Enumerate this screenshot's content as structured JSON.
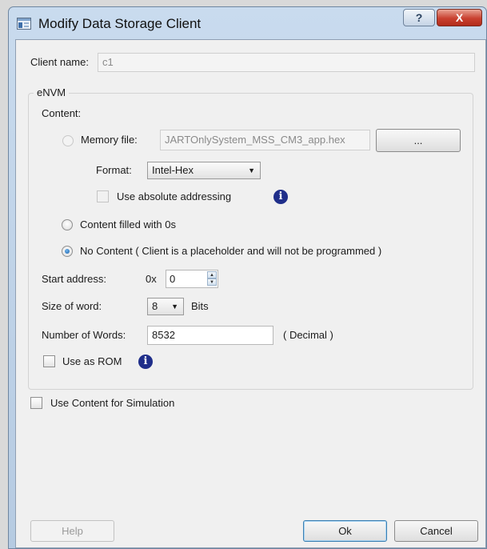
{
  "window": {
    "title": "Modify Data Storage Client",
    "help_glyph": "?",
    "close_glyph": "X"
  },
  "client_name": {
    "label": "Client name:",
    "value": "c1"
  },
  "envm": {
    "group_title": "eNVM",
    "content_label": "Content:",
    "memory_file": {
      "radio_label": "Memory file:",
      "path": "JARTOnlySystem_MSS_CM3_app.hex",
      "browse_label": "..."
    },
    "format": {
      "label": "Format:",
      "value": "Intel-Hex"
    },
    "absolute_addressing": {
      "label": "Use absolute addressing",
      "checked": false
    },
    "filled_zeros": {
      "label": "Content filled with 0s"
    },
    "no_content": {
      "label": "No Content ( Client is a placeholder and will not be programmed )",
      "selected": true
    },
    "start_address": {
      "label": "Start address:",
      "prefix": "0x",
      "value": "0"
    },
    "word_size": {
      "label": "Size of word:",
      "value": "8",
      "unit": "Bits"
    },
    "num_words": {
      "label": "Number of Words:",
      "value": "8532",
      "note": "( Decimal )"
    },
    "use_as_rom": {
      "label": "Use as ROM",
      "checked": false
    }
  },
  "simulation": {
    "label": "Use Content for Simulation",
    "checked": false
  },
  "footer": {
    "help": "Help",
    "ok": "Ok",
    "cancel": "Cancel"
  },
  "icons": {
    "info": "info-icon",
    "dropdown": "chevron-down-icon",
    "spin_up": "arrow-up-icon",
    "spin_down": "arrow-down-icon"
  },
  "colors": {
    "info_icon": "#1f2e8a",
    "close_button": "#c94130",
    "title_bar": "#c9dbee"
  }
}
